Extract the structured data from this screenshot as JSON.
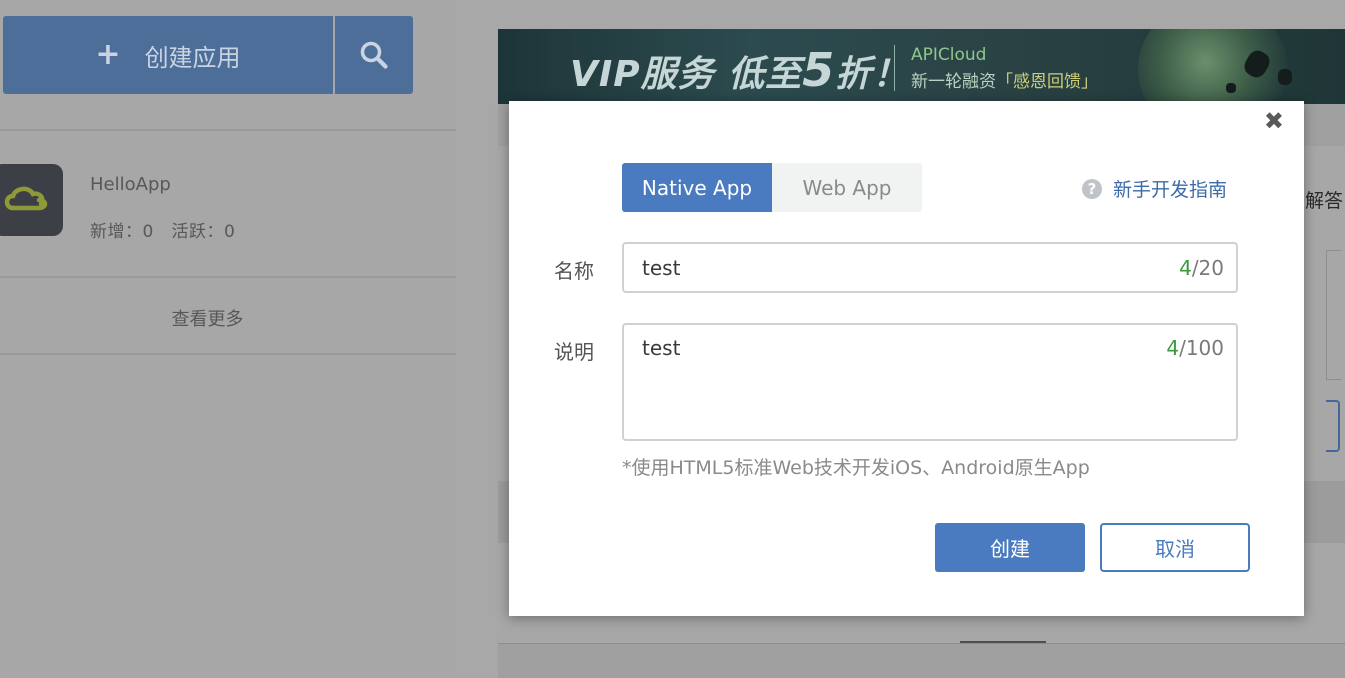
{
  "sidebar": {
    "create_button_label": "创建应用",
    "app": {
      "name": "HelloApp",
      "stats": "新增：0   活跃：0"
    },
    "see_more": "查看更多"
  },
  "banner": {
    "headline": "VIP服务 低至",
    "headline_number": "5",
    "headline_suffix": "折！",
    "brand": "APICloud",
    "tagline_prefix": "新一轮融资",
    "tagline_highlight": "「感恩回馈」"
  },
  "background": {
    "partial_text": "解答"
  },
  "modal": {
    "tabs": [
      {
        "label": "Native App",
        "active": true
      },
      {
        "label": "Web App",
        "active": false
      }
    ],
    "guide_link": "新手开发指南",
    "name_field": {
      "label": "名称",
      "value": "test",
      "count": "4",
      "max": "/20"
    },
    "desc_field": {
      "label": "说明",
      "value": "test",
      "count": "4",
      "max": "/100"
    },
    "hint": "*使用HTML5标准Web技术开发iOS、Android原生App",
    "create_button": "创建",
    "cancel_button": "取消"
  },
  "colors": {
    "primary": "#4a7ac0",
    "overlay_button": "#4d6e98",
    "counter_green": "#3a9a3a"
  }
}
